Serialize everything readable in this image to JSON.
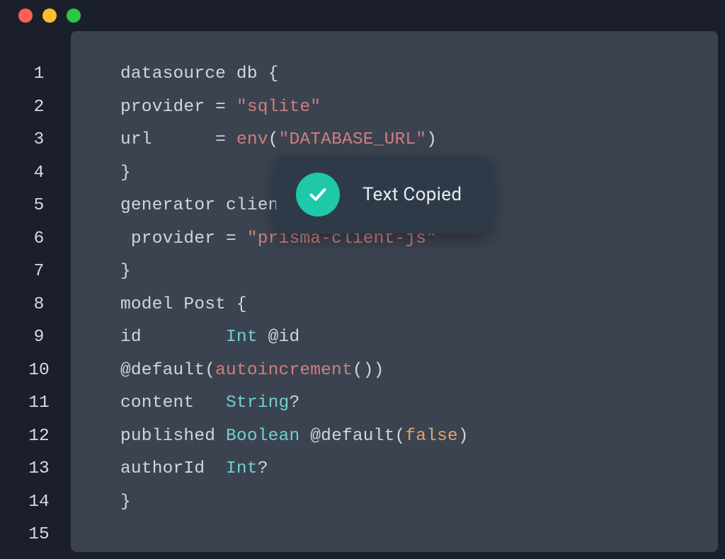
{
  "window": {
    "traffic_lights": [
      "close",
      "minimize",
      "zoom"
    ]
  },
  "toast": {
    "message": "Text Copied",
    "icon": "check-icon"
  },
  "gutter": {
    "start": 1,
    "end": 15
  },
  "code": {
    "lines": [
      {
        "n": 1,
        "tokens": [
          {
            "t": "datasource db {",
            "c": "tok-key"
          }
        ]
      },
      {
        "n": 2,
        "tokens": [
          {
            "t": "provider = ",
            "c": "tok-key"
          },
          {
            "t": "\"sqlite\"",
            "c": "tok-str"
          }
        ]
      },
      {
        "n": 3,
        "tokens": [
          {
            "t": "url      = ",
            "c": "tok-key"
          },
          {
            "t": "env",
            "c": "tok-func"
          },
          {
            "t": "(",
            "c": "tok-punct"
          },
          {
            "t": "\"DATABASE_URL\"",
            "c": "tok-str"
          },
          {
            "t": ")",
            "c": "tok-punct"
          }
        ]
      },
      {
        "n": 4,
        "tokens": [
          {
            "t": "}",
            "c": "tok-punct"
          }
        ]
      },
      {
        "n": 5,
        "tokens": [
          {
            "t": "",
            "c": "tok-key"
          }
        ]
      },
      {
        "n": 6,
        "tokens": [
          {
            "t": "generator client {",
            "c": "tok-key"
          }
        ]
      },
      {
        "n": 7,
        "tokens": [
          {
            "t": " provider = ",
            "c": "tok-key"
          },
          {
            "t": "\"prisma-client-js\"",
            "c": "tok-str"
          }
        ]
      },
      {
        "n": 8,
        "tokens": [
          {
            "t": "}",
            "c": "tok-punct"
          }
        ]
      },
      {
        "n": 9,
        "tokens": [
          {
            "t": "model Post {",
            "c": "tok-key"
          }
        ]
      },
      {
        "n": 10,
        "tokens": [
          {
            "t": "id        ",
            "c": "tok-key"
          },
          {
            "t": "Int",
            "c": "tok-type"
          },
          {
            "t": " @id",
            "c": "tok-attr"
          }
        ]
      },
      {
        "n": 11,
        "tokens": [
          {
            "t": "@default(",
            "c": "tok-attr"
          },
          {
            "t": "autoincrement",
            "c": "tok-func"
          },
          {
            "t": "())",
            "c": "tok-punct"
          }
        ]
      },
      {
        "n": 12,
        "tokens": [
          {
            "t": "content   ",
            "c": "tok-key"
          },
          {
            "t": "String",
            "c": "tok-type"
          },
          {
            "t": "?",
            "c": "tok-op"
          }
        ]
      },
      {
        "n": 13,
        "tokens": [
          {
            "t": "published ",
            "c": "tok-key"
          },
          {
            "t": "Boolean",
            "c": "tok-type"
          },
          {
            "t": " @default(",
            "c": "tok-attr"
          },
          {
            "t": "false",
            "c": "tok-bool"
          },
          {
            "t": ")",
            "c": "tok-punct"
          }
        ]
      },
      {
        "n": 14,
        "tokens": [
          {
            "t": "authorId  ",
            "c": "tok-key"
          },
          {
            "t": "Int",
            "c": "tok-type"
          },
          {
            "t": "?",
            "c": "tok-op"
          }
        ]
      },
      {
        "n": 15,
        "tokens": [
          {
            "t": "}",
            "c": "tok-punct"
          }
        ]
      }
    ]
  }
}
